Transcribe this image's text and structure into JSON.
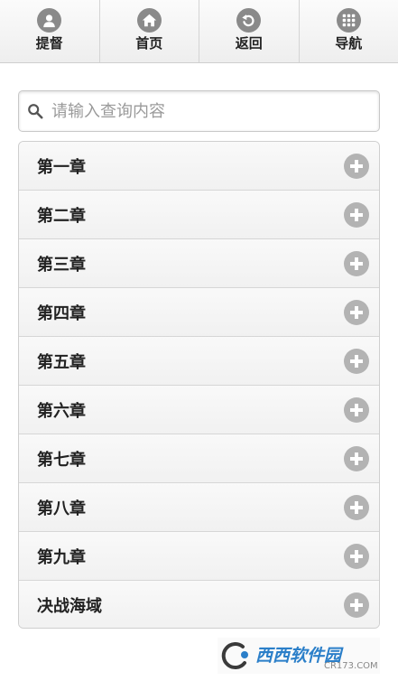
{
  "nav": [
    {
      "label": "提督",
      "icon": "user-icon"
    },
    {
      "label": "首页",
      "icon": "home-icon"
    },
    {
      "label": "返回",
      "icon": "back-icon"
    },
    {
      "label": "导航",
      "icon": "grid-icon"
    }
  ],
  "search": {
    "placeholder": "请输入查询内容",
    "value": ""
  },
  "chapters": [
    {
      "label": "第一章"
    },
    {
      "label": "第二章"
    },
    {
      "label": "第三章"
    },
    {
      "label": "第四章"
    },
    {
      "label": "第五章"
    },
    {
      "label": "第六章"
    },
    {
      "label": "第七章"
    },
    {
      "label": "第八章"
    },
    {
      "label": "第九章"
    },
    {
      "label": "决战海域"
    }
  ],
  "watermark": {
    "name": "西西软件园",
    "sub": "CR173.COM"
  },
  "colors": {
    "icon_gray": "#8a8a8a",
    "plus_gray": "#b3b3b3",
    "watermark_blue": "#2b7fc9"
  }
}
